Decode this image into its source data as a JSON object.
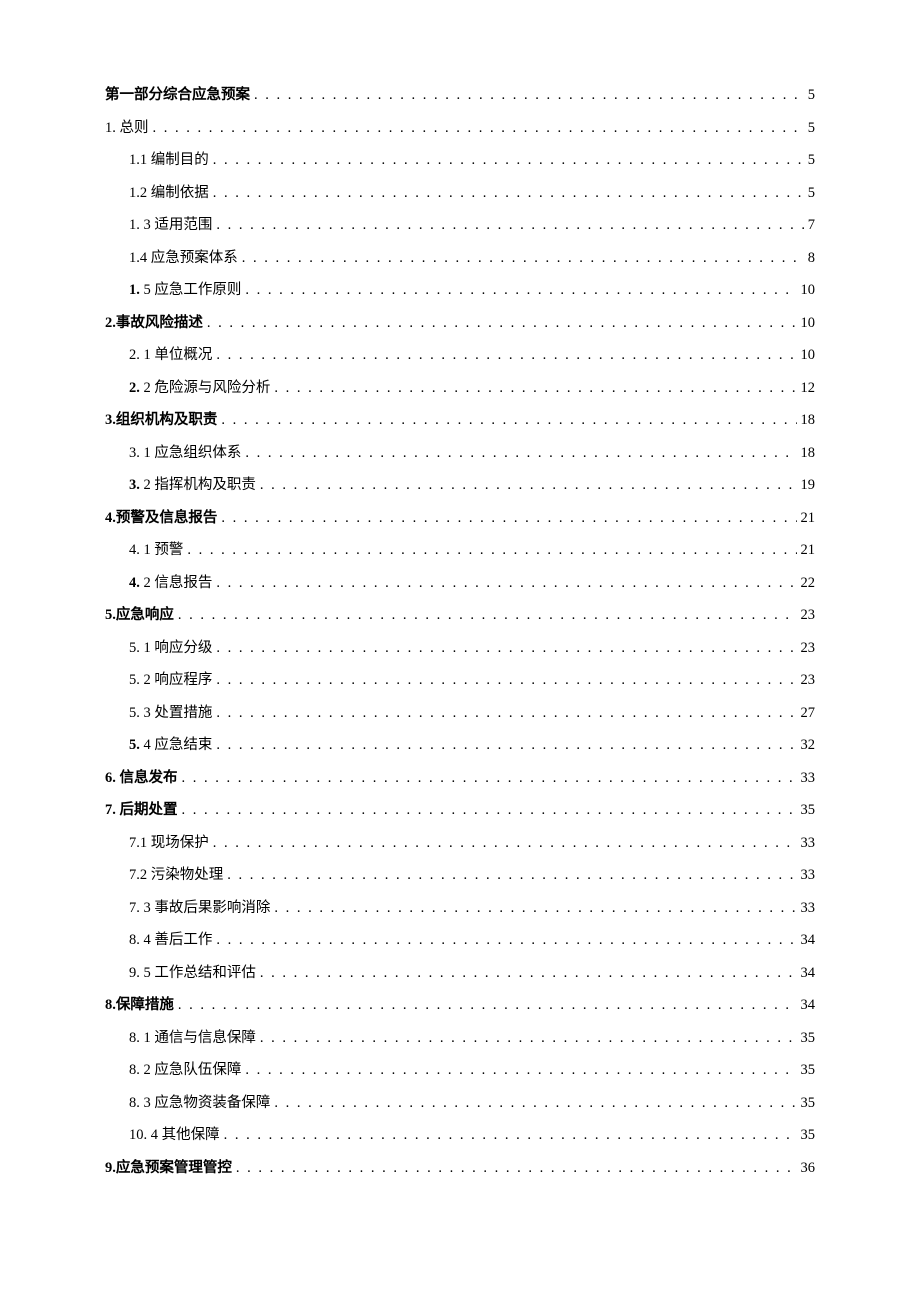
{
  "toc": [
    {
      "level": 0,
      "bold": "第一部分综合应急预案",
      "plain": "",
      "page": "5"
    },
    {
      "level": 0,
      "bold": "",
      "plain": "1. 总则",
      "page": "5"
    },
    {
      "level": 1,
      "bold": "",
      "plain": "1.1 编制目的",
      "page": "5"
    },
    {
      "level": 1,
      "bold": "",
      "plain": "1.2 编制依据",
      "page": "5"
    },
    {
      "level": 1,
      "bold": "",
      "plain": "1. 3 适用范围",
      "page": "7"
    },
    {
      "level": 1,
      "bold": "",
      "plain": "1.4 应急预案体系",
      "page": "8"
    },
    {
      "level": 1,
      "bold": "1.",
      "plain": " 5 应急工作原则",
      "page": "10"
    },
    {
      "level": 0,
      "bold": "2.事故风险描述",
      "plain": "",
      "page": "10"
    },
    {
      "level": 1,
      "bold": "",
      "plain": "2.  1 单位概况",
      "page": "10"
    },
    {
      "level": 1,
      "bold": "2.",
      "plain": " 2 危险源与风险分析",
      "page": "12"
    },
    {
      "level": 0,
      "bold": "3.组织机构及职责",
      "plain": "",
      "page": "18"
    },
    {
      "level": 1,
      "bold": "",
      "plain": "3.  1 应急组织体系",
      "page": "18"
    },
    {
      "level": 1,
      "bold": "3.",
      "plain": " 2 指挥机构及职责",
      "page": "19"
    },
    {
      "level": 0,
      "bold": "4.预警及信息报告",
      "plain": "",
      "page": "21"
    },
    {
      "level": 1,
      "bold": "",
      "plain": "4.  1 预警",
      "page": "21"
    },
    {
      "level": 1,
      "bold": "4.",
      "plain": " 2 信息报告",
      "page": "22"
    },
    {
      "level": 0,
      "bold": "5.应急响应",
      "plain": "",
      "page": "23"
    },
    {
      "level": 1,
      "bold": "",
      "plain": "5.  1 响应分级",
      "page": "23"
    },
    {
      "level": 1,
      "bold": "",
      "plain": "5.  2 响应程序",
      "page": "23"
    },
    {
      "level": 1,
      "bold": "",
      "plain": "5.  3 处置措施",
      "page": "27"
    },
    {
      "level": 1,
      "bold": "5.",
      "plain": " 4 应急结束",
      "page": "32"
    },
    {
      "level": 0,
      "bold": "6.   信息发布",
      "plain": "",
      "page": "33"
    },
    {
      "level": 0,
      "bold": "7.   后期处置",
      "plain": "",
      "page": "35"
    },
    {
      "level": 1,
      "bold": "",
      "plain": "7.1 现场保护",
      "page": "33"
    },
    {
      "level": 1,
      "bold": "",
      "plain": "7.2 污染物处理",
      "page": "33"
    },
    {
      "level": 1,
      "bold": "",
      "plain": "7.  3 事故后果影响消除",
      "page": "33"
    },
    {
      "level": 1,
      "bold": "",
      "plain": "8.  4 善后工作",
      "page": "34"
    },
    {
      "level": 1,
      "bold": "",
      "plain": "9.  5 工作总结和评估",
      "page": "34"
    },
    {
      "level": 0,
      "bold": "8.保障措施",
      "plain": "",
      "page": "34"
    },
    {
      "level": 1,
      "bold": "",
      "plain": "8.  1 通信与信息保障",
      "page": "35"
    },
    {
      "level": 1,
      "bold": "",
      "plain": "8.  2 应急队伍保障",
      "page": "35"
    },
    {
      "level": 1,
      "bold": "",
      "plain": "8.  3 应急物资装备保障",
      "page": "35"
    },
    {
      "level": 1,
      "bold": "",
      "plain": "10. 4 其他保障",
      "page": "35"
    },
    {
      "level": 0,
      "bold": "9.应急预案管理管控",
      "plain": "",
      "page": "36"
    }
  ]
}
